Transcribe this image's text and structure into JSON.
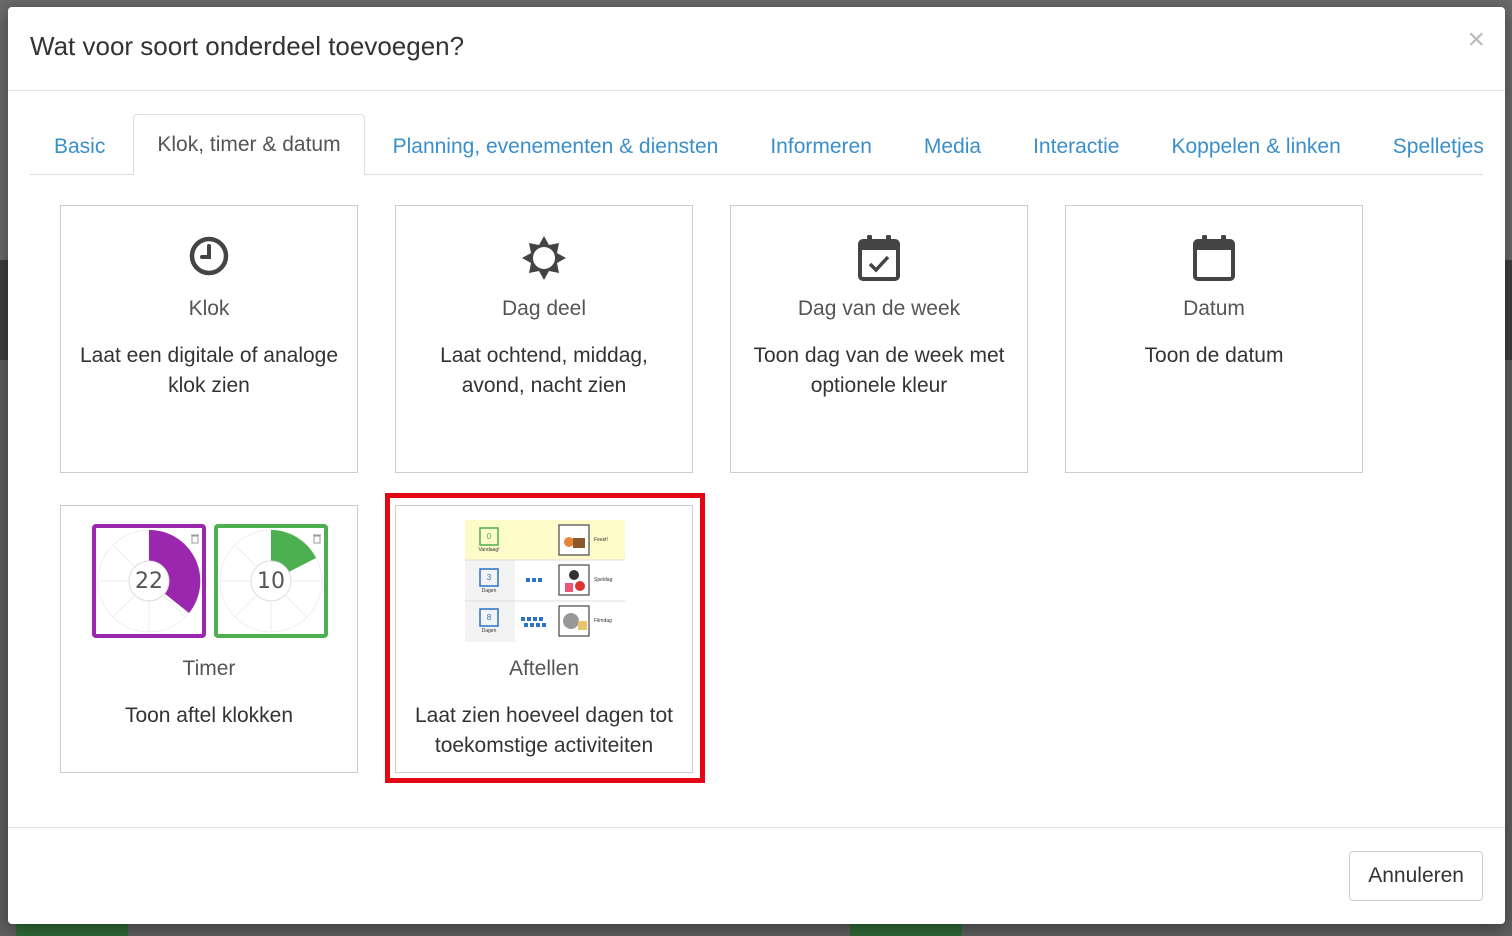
{
  "modal": {
    "title": "Wat voor soort onderdeel toevoegen?",
    "close_label": "×"
  },
  "tabs": [
    {
      "label": "Basic",
      "active": false
    },
    {
      "label": "Klok, timer & datum",
      "active": true
    },
    {
      "label": "Planning, evenementen & diensten",
      "active": false
    },
    {
      "label": "Informeren",
      "active": false
    },
    {
      "label": "Media",
      "active": false
    },
    {
      "label": "Interactie",
      "active": false
    },
    {
      "label": "Koppelen & linken",
      "active": false
    },
    {
      "label": "Spelletjes",
      "active": false
    }
  ],
  "cards": [
    {
      "title": "Klok",
      "desc": "Laat een digitale of analoge klok zien",
      "icon": "clock-icon"
    },
    {
      "title": "Dag deel",
      "desc": "Laat ochtend, middag, avond, nacht zien",
      "icon": "sun-icon"
    },
    {
      "title": "Dag van de week",
      "desc": "Toon dag van de week met optionele kleur",
      "icon": "calendar-check-icon"
    },
    {
      "title": "Datum",
      "desc": "Toon de datum",
      "icon": "calendar-icon"
    },
    {
      "title": "Timer",
      "desc": "Toon aftel klokken",
      "icon": "timer-preview"
    },
    {
      "title": "Aftellen",
      "desc": "Laat zien hoeveel dagen tot toekomstige activiteiten",
      "icon": "countdown-preview"
    }
  ],
  "timer_preview": {
    "left": {
      "number": "22",
      "color": "#9b27af",
      "fraction": 0.42
    },
    "right": {
      "number": "10",
      "color": "#4caf50",
      "fraction": 0.17
    }
  },
  "countdown_preview": {
    "rows": [
      {
        "num": "0",
        "label": "Vandaag!",
        "event": "Feest!",
        "color": "#4caf50",
        "dots": 0
      },
      {
        "num": "3",
        "label": "Dagen",
        "event": "Speldag",
        "color": "#2a73c9",
        "dots": 3
      },
      {
        "num": "8",
        "label": "Dagen",
        "event": "Filmdag",
        "color": "#2a73c9",
        "dots": 8
      }
    ]
  },
  "footer": {
    "cancel_label": "Annuleren"
  },
  "colors": {
    "link": "#3a8fcb",
    "highlight": "#e30613"
  }
}
